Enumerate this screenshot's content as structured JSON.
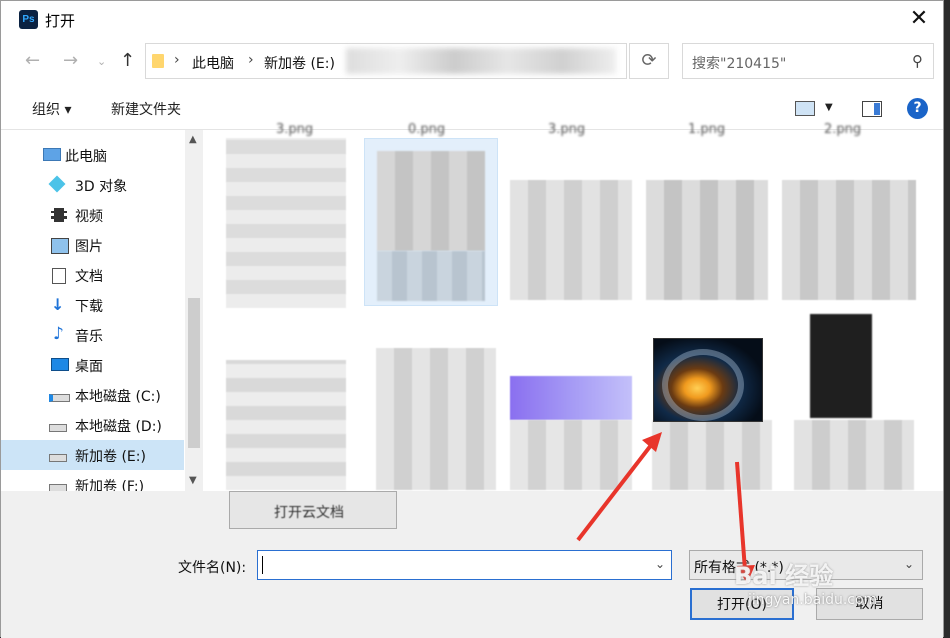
{
  "window": {
    "title": "打开",
    "app_icon": "Ps"
  },
  "nav": {
    "breadcrumb": [
      "此电脑",
      "新加卷 (E:)"
    ],
    "search_placeholder": "搜索\"210415\""
  },
  "toolbar": {
    "organize": "组织 ▾",
    "new_folder": "新建文件夹",
    "help": "?"
  },
  "sidebar": {
    "items": [
      {
        "label": "此电脑",
        "icon": "computer-icon"
      },
      {
        "label": "3D 对象",
        "icon": "cube-icon"
      },
      {
        "label": "视频",
        "icon": "video-icon"
      },
      {
        "label": "图片",
        "icon": "picture-icon"
      },
      {
        "label": "文档",
        "icon": "document-icon"
      },
      {
        "label": "下载",
        "icon": "download-icon"
      },
      {
        "label": "音乐",
        "icon": "music-icon"
      },
      {
        "label": "桌面",
        "icon": "desktop-icon"
      },
      {
        "label": "本地磁盘 (C:)",
        "icon": "drive-icon"
      },
      {
        "label": "本地磁盘 (D:)",
        "icon": "drive-icon"
      },
      {
        "label": "新加卷 (E:)",
        "icon": "drive-icon",
        "selected": true
      },
      {
        "label": "新加卷 (F:)",
        "icon": "drive-icon"
      }
    ]
  },
  "files": {
    "top_labels": [
      "3.png",
      "0.png",
      "3.png",
      "1.png",
      "2.png"
    ]
  },
  "bottom": {
    "open_doc_button": "打开云文档",
    "filename_label": "文件名(N):",
    "filename_value": "",
    "filetype_value": "所有格式 (*.*)",
    "open_button": "打开(O)",
    "cancel_button": "取消"
  },
  "watermark": {
    "text": "Bai 经验",
    "url": "jingyan.baidu.com"
  }
}
